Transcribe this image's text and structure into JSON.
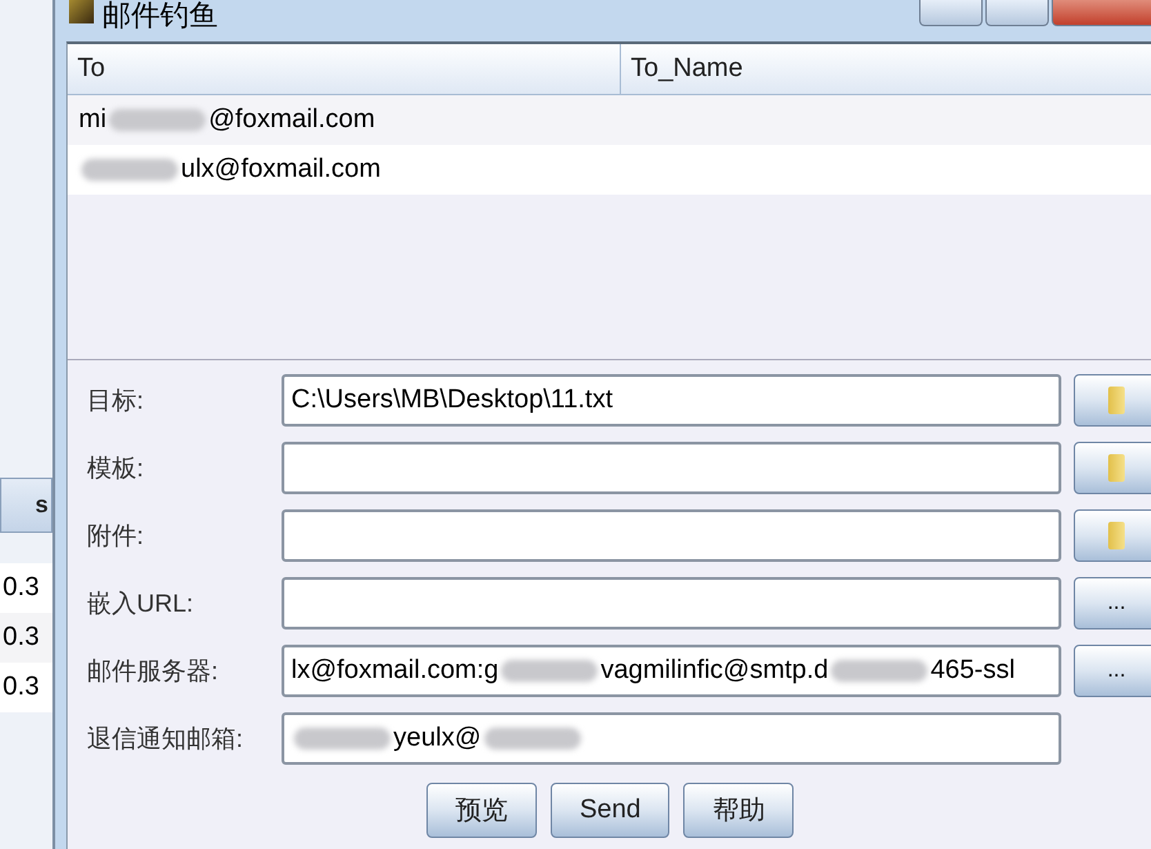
{
  "background_window": {
    "button": "s",
    "rows": [
      "0.3",
      "0.3",
      "0.3"
    ]
  },
  "window": {
    "title": "邮件钓鱼"
  },
  "table": {
    "columns": [
      "To",
      "To_Name"
    ],
    "rows": [
      {
        "to": [
          {
            "kind": "text",
            "text": "mi"
          },
          {
            "kind": "blur"
          },
          {
            "kind": "text",
            "text": "@foxmail.com"
          }
        ]
      },
      {
        "to": [
          {
            "kind": "blur"
          },
          {
            "kind": "text",
            "text": "ulx@foxmail.com"
          }
        ]
      }
    ]
  },
  "fields": [
    {
      "label": "目标:",
      "button": {
        "kind": "folder"
      },
      "value": [
        {
          "kind": "text",
          "text": "C:\\Users\\MB\\Desktop\\11.txt"
        }
      ]
    },
    {
      "label": "模板:",
      "button": {
        "kind": "folder"
      }
    },
    {
      "label": "附件:",
      "button": {
        "kind": "folder"
      }
    },
    {
      "label": "嵌入URL:",
      "button": {
        "kind": "text",
        "text": "..."
      }
    },
    {
      "label": "邮件服务器:",
      "button": {
        "kind": "text",
        "text": "..."
      },
      "value": [
        {
          "kind": "text",
          "text": "lx@foxmail.com:g"
        },
        {
          "kind": "blur"
        },
        {
          "kind": "text",
          "text": "vagmilinfic@smtp.d"
        },
        {
          "kind": "blur"
        },
        {
          "kind": "text",
          "text": "465-ssl"
        }
      ]
    },
    {
      "label": "退信通知邮箱:",
      "value": [
        {
          "kind": "blur"
        },
        {
          "kind": "text",
          "text": "yeulx@"
        },
        {
          "kind": "blur"
        }
      ]
    }
  ],
  "buttons": [
    "预览",
    "Send",
    "帮助"
  ]
}
